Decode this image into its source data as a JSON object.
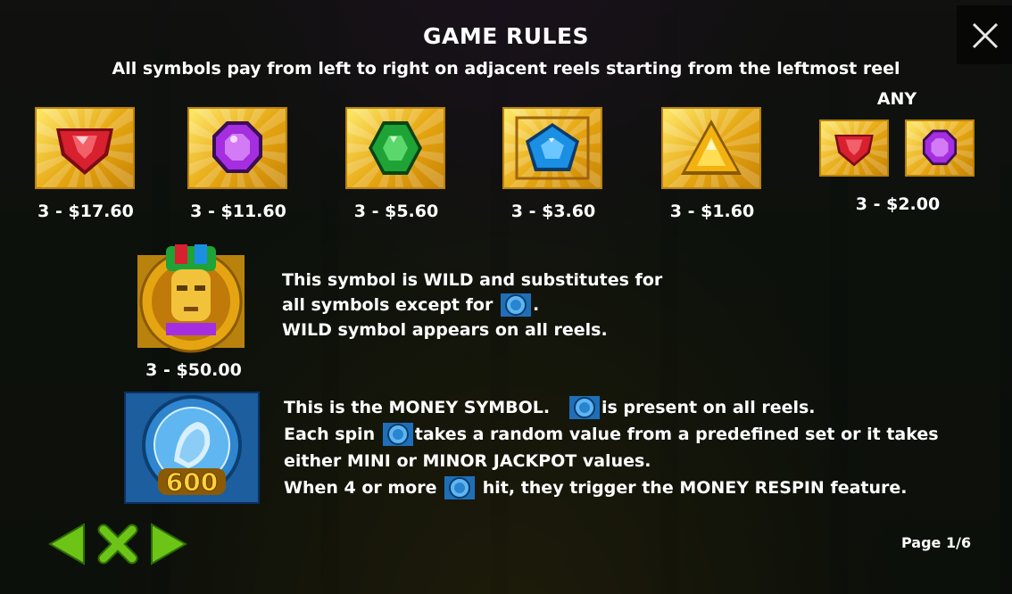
{
  "header": {
    "title": "GAME RULES",
    "subtitle": "All symbols pay from left to right on adjacent reels starting from the leftmost reel"
  },
  "close_icon": "close-icon",
  "symbols": [
    {
      "gem": "red-shield-gem",
      "color": "#d8202e",
      "pay": "3 - $17.60"
    },
    {
      "gem": "purple-octagon-gem",
      "color": "#a52ee0",
      "pay": "3 - $11.60"
    },
    {
      "gem": "green-hexagon-gem",
      "color": "#1fa336",
      "pay": "3 - $5.60"
    },
    {
      "gem": "blue-pentagon-gem",
      "color": "#1a8fe3",
      "pay": "3 - $3.60"
    },
    {
      "gem": "yellow-triangle-gem",
      "color": "#f3b210",
      "pay": "3 - $1.60"
    }
  ],
  "any": {
    "label": "ANY",
    "pay": "3 - $2.00"
  },
  "wild": {
    "pay": "3 - $50.00",
    "line1": "This symbol is WILD and substitutes for",
    "line2_pre": "all symbols except for ",
    "line2_post": ".",
    "line3": "WILD symbol appears on all reels."
  },
  "money": {
    "coin_value": "600",
    "line1_pre": "This is the MONEY SYMBOL.",
    "line1_post": "is present on all reels.",
    "line2_pre": "Each spin",
    "line2_post": "takes a random value from a predefined set or it takes",
    "line3": "either  MINI or MINOR JACKPOT values.",
    "line4_pre": "When 4 or more",
    "line4_post": " hit, they trigger the MONEY RESPIN feature."
  },
  "nav": {
    "prev_icon": "arrow-left-icon",
    "close_icon": "x-close-icon",
    "next_icon": "arrow-right-icon",
    "color": "#6cc417"
  },
  "pager": {
    "label": "Page 1/6"
  }
}
